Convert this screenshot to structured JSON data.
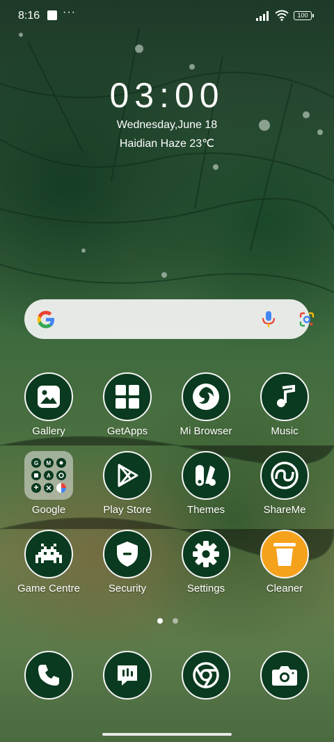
{
  "status_bar": {
    "time": "8:16",
    "more": "···",
    "battery": "100"
  },
  "lockscreen_widget": {
    "clock": "03:00",
    "date": "Wednesday,June 18",
    "weather": "Haidian Haze 23℃"
  },
  "search_bar": {
    "logo": "google-g-icon",
    "voice": "mic-icon",
    "lens": "google-lens-icon"
  },
  "apps": [
    {
      "label": "Gallery",
      "icon": "gallery-icon"
    },
    {
      "label": "GetApps",
      "icon": "getapps-icon"
    },
    {
      "label": "Mi Browser",
      "icon": "browser-icon"
    },
    {
      "label": "Music",
      "icon": "music-note-icon"
    },
    {
      "label": "Google",
      "icon": "folder-icon"
    },
    {
      "label": "Play Store",
      "icon": "play-store-icon"
    },
    {
      "label": "Themes",
      "icon": "themes-icon"
    },
    {
      "label": "ShareMe",
      "icon": "shareme-icon"
    },
    {
      "label": "Game Centre",
      "icon": "game-invader-icon"
    },
    {
      "label": "Security",
      "icon": "shield-icon"
    },
    {
      "label": "Settings",
      "icon": "gear-icon"
    },
    {
      "label": "Cleaner",
      "icon": "trash-icon"
    }
  ],
  "dock": [
    {
      "icon": "phone-icon"
    },
    {
      "icon": "messages-icon"
    },
    {
      "icon": "chrome-icon"
    },
    {
      "icon": "camera-icon"
    }
  ],
  "pager": {
    "pages": 2,
    "current": 1
  },
  "colors": {
    "icon_bg": "#0a3a1f",
    "cleaner_bg": "#f4a21c",
    "search_bg": "#f5f5f5"
  }
}
